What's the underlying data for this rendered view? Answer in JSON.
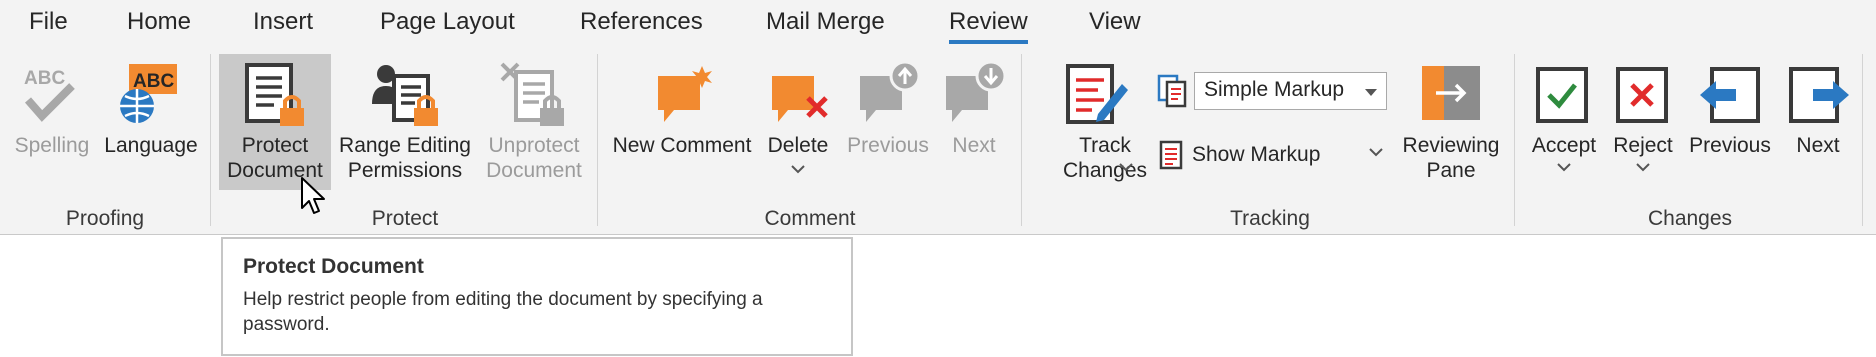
{
  "tabs": [
    {
      "label": "File"
    },
    {
      "label": "Home"
    },
    {
      "label": "Insert"
    },
    {
      "label": "Page Layout"
    },
    {
      "label": "References"
    },
    {
      "label": "Mail Merge"
    },
    {
      "label": "Review"
    },
    {
      "label": "View"
    }
  ],
  "active_tab": "Review",
  "groups": {
    "proofing": {
      "label": "Proofing",
      "spelling": "Spelling",
      "language": "Language",
      "abc": "ABC"
    },
    "protect": {
      "label": "Protect",
      "protect_line1": "Protect",
      "protect_line2": "Document",
      "range_line1": "Range Editing",
      "range_line2": "Permissions",
      "unprotect_line1": "Unprotect",
      "unprotect_line2": "Document"
    },
    "comment": {
      "label": "Comment",
      "new_comment": "New Comment",
      "delete": "Delete",
      "previous": "Previous",
      "next": "Next"
    },
    "tracking": {
      "label": "Tracking",
      "track_line1": "Track",
      "track_line2": "Changes",
      "markup_mode": "Simple Markup",
      "show_markup": "Show Markup",
      "reviewing_line1": "Reviewing",
      "reviewing_line2": "Pane"
    },
    "changes": {
      "label": "Changes",
      "accept": "Accept",
      "reject": "Reject",
      "previous": "Previous",
      "next": "Next"
    }
  },
  "tooltip": {
    "title": "Protect Document",
    "body": "Help restrict people from editing the document by specifying a password."
  },
  "colors": {
    "accent_blue": "#2b79c2",
    "orange": "#f28a30",
    "red": "#e12b2b",
    "green": "#2e8b3e"
  }
}
